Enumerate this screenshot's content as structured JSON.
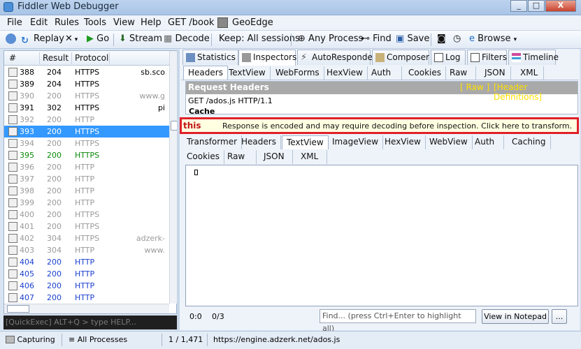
{
  "window": {
    "title": "Fiddler Web Debugger",
    "buttons": [
      "_",
      "□",
      "X"
    ]
  },
  "menu": [
    "File",
    "Edit",
    "Rules",
    "Tools",
    "View",
    "Help",
    "GET /book",
    "GeoEdge"
  ],
  "toolbar": {
    "replay": "Replay",
    "go": "Go",
    "stream": "Stream",
    "decode": "Decode",
    "keep": "Keep: All sessions",
    "any_process": "Any Process",
    "find": "Find",
    "save": "Save",
    "browse": "Browse"
  },
  "sessions": {
    "headers": [
      "#",
      "Result",
      "Protocol"
    ],
    "rows": [
      {
        "num": "388",
        "result": "204",
        "protocol": "HTTPS",
        "host": "sb.sco",
        "color": "#000000",
        "icon": "info-icon"
      },
      {
        "num": "389",
        "result": "204",
        "protocol": "HTTPS",
        "host": "",
        "color": "#000000",
        "icon": "info-icon"
      },
      {
        "num": "390",
        "result": "200",
        "protocol": "HTTPS",
        "host": "www.g",
        "color": "#9a9a9a",
        "icon": "image-icon"
      },
      {
        "num": "391",
        "result": "302",
        "protocol": "HTTPS",
        "host": "pi",
        "color": "#000000",
        "icon": "redirect-icon"
      },
      {
        "num": "392",
        "result": "200",
        "protocol": "HTTP",
        "host": "",
        "color": "#9a9a9a",
        "icon": "lock-icon"
      },
      {
        "num": "393",
        "result": "200",
        "protocol": "HTTPS",
        "host": "",
        "color": "#ffffff",
        "icon": "js-icon",
        "selected": true
      },
      {
        "num": "394",
        "result": "200",
        "protocol": "HTTPS",
        "host": "",
        "color": "#9a9a9a",
        "icon": "image-icon"
      },
      {
        "num": "395",
        "result": "200",
        "protocol": "HTTPS",
        "host": "",
        "color": "#0c8a0c",
        "icon": "js-icon"
      },
      {
        "num": "396",
        "result": "200",
        "protocol": "HTTP",
        "host": "",
        "color": "#9a9a9a",
        "icon": "image-icon"
      },
      {
        "num": "397",
        "result": "200",
        "protocol": "HTTP",
        "host": "",
        "color": "#9a9a9a",
        "icon": "image-icon"
      },
      {
        "num": "398",
        "result": "200",
        "protocol": "HTTP",
        "host": "",
        "color": "#9a9a9a",
        "icon": "image-icon"
      },
      {
        "num": "399",
        "result": "200",
        "protocol": "HTTP",
        "host": "",
        "color": "#9a9a9a",
        "icon": "image-icon"
      },
      {
        "num": "400",
        "result": "200",
        "protocol": "HTTPS",
        "host": "",
        "color": "#9a9a9a",
        "icon": "image-icon"
      },
      {
        "num": "401",
        "result": "200",
        "protocol": "HTTPS",
        "host": "",
        "color": "#9a9a9a",
        "icon": "image-icon"
      },
      {
        "num": "402",
        "result": "304",
        "protocol": "HTTPS",
        "host": "adzerk-www.",
        "color": "#9a9a9a",
        "icon": "diamond-icon"
      },
      {
        "num": "403",
        "result": "304",
        "protocol": "HTTP",
        "host": "",
        "color": "#9a9a9a",
        "icon": "diamond-icon"
      },
      {
        "num": "404",
        "result": "200",
        "protocol": "HTTP",
        "host": "",
        "color": "#1a3fd0",
        "icon": "html-icon"
      },
      {
        "num": "405",
        "result": "200",
        "protocol": "HTTP",
        "host": "",
        "color": "#1a3fd0",
        "icon": "html-icon"
      },
      {
        "num": "406",
        "result": "200",
        "protocol": "HTTP",
        "host": "",
        "color": "#1a3fd0",
        "icon": "html-icon"
      },
      {
        "num": "407",
        "result": "200",
        "protocol": "HTTP",
        "host": "",
        "color": "#1a3fd0",
        "icon": "html-icon"
      }
    ]
  },
  "quickexec": "[QuickExec] ALT+Q > type HELP...",
  "tabs": [
    "Statistics",
    "Inspectors",
    "AutoResponder",
    "Composer",
    "Log",
    "Filters",
    "Timeline"
  ],
  "request_tabs": [
    "Headers",
    "TextView",
    "WebForms",
    "HexView",
    "Auth",
    "Cookies",
    "Raw",
    "JSON",
    "XML"
  ],
  "request": {
    "title": "Request Headers",
    "raw_link": "[ Raw ]",
    "defs_link": "[Header Definitions]",
    "line": "GET /ados.js HTTP/1.1",
    "group": "Cache"
  },
  "notice": {
    "label": "this",
    "message": "Response is encoded and may require decoding before inspection. Click here to transform."
  },
  "response_tabs_row1": [
    "Transformer",
    "Headers",
    "TextView",
    "ImageView",
    "HexView",
    "WebView",
    "Auth",
    "Caching"
  ],
  "response_tabs_row2": [
    "Cookies",
    "Raw",
    "JSON",
    "XML"
  ],
  "response_bottom": {
    "position": "0:0",
    "count": "0/3",
    "find_placeholder": "Find... (press Ctrl+Enter to highlight all)",
    "notepad_button": "View in Notepad",
    "more_button": "..."
  },
  "status": {
    "capturing": "Capturing",
    "processes": "All Processes",
    "count": "1 / 1,471",
    "url": "https://engine.adzerk.net/ados.js"
  },
  "colors": {
    "selection": "#3399ff",
    "notice_border": "#e0202a",
    "req_header_bg": "#a9a9a9",
    "req_link": "#ffe000"
  }
}
